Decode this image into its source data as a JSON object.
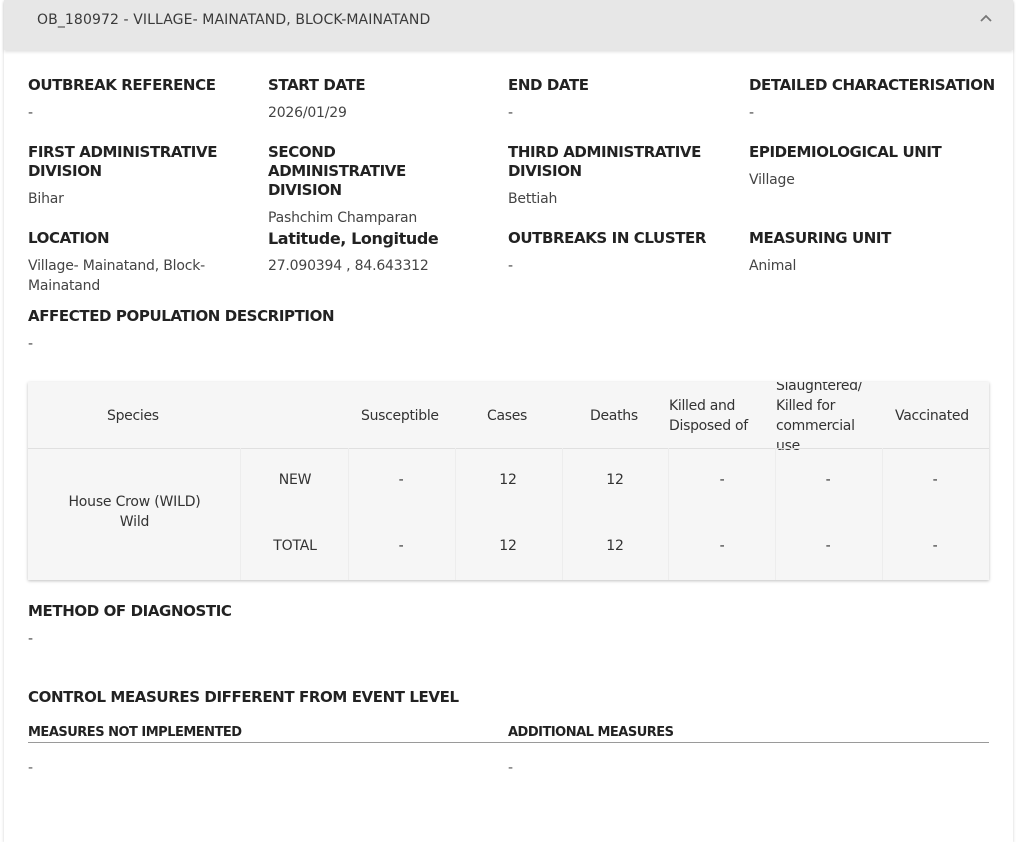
{
  "header": {
    "title": "OB_180972 - VILLAGE- MAINATAND, BLOCK-MAINATAND"
  },
  "fields": {
    "outbreak_reference": {
      "label": "OUTBREAK REFERENCE",
      "value": "-"
    },
    "start_date": {
      "label": "START DATE",
      "value": "2026/01/29"
    },
    "end_date": {
      "label": "END DATE",
      "value": "-"
    },
    "detailed_characterisation": {
      "label": "DETAILED CHARACTERISATION",
      "value": "-"
    },
    "first_admin": {
      "label": "FIRST ADMINISTRATIVE DIVISION",
      "value": "Bihar"
    },
    "second_admin": {
      "label": "SECOND ADMINISTRATIVE DIVISION",
      "value": "Pashchim Champaran"
    },
    "third_admin": {
      "label": "THIRD ADMINISTRATIVE DIVISION",
      "value": "Bettiah"
    },
    "epi_unit": {
      "label": "EPIDEMIOLOGICAL UNIT",
      "value": "Village"
    },
    "location": {
      "label": "LOCATION",
      "value": "Village- Mainatand, Block-Mainatand"
    },
    "lat_long": {
      "label": "Latitude, Longitude",
      "value": "27.090394 , 84.643312"
    },
    "outbreaks_in_cluster": {
      "label": "OUTBREAKS IN CLUSTER",
      "value": "-"
    },
    "measuring_unit": {
      "label": "MEASURING UNIT",
      "value": "Animal"
    },
    "affected_population": {
      "label": "AFFECTED POPULATION DESCRIPTION",
      "value": "-"
    }
  },
  "table": {
    "headers": {
      "species": "Species",
      "susceptible": "Susceptible",
      "cases": "Cases",
      "deaths": "Deaths",
      "killed": "Killed and Disposed of",
      "slaughtered": "Slaughtered/ Killed for commercial use",
      "vaccinated": "Vaccinated"
    },
    "species_name": "House Crow (WILD)",
    "species_type": "Wild",
    "rows": [
      {
        "label": "NEW",
        "susceptible": "-",
        "cases": "12",
        "deaths": "12",
        "killed": "-",
        "slaughtered": "-",
        "vaccinated": "-"
      },
      {
        "label": "TOTAL",
        "susceptible": "-",
        "cases": "12",
        "deaths": "12",
        "killed": "-",
        "slaughtered": "-",
        "vaccinated": "-"
      }
    ]
  },
  "diagnostic": {
    "label": "METHOD OF DIAGNOSTIC",
    "value": "-"
  },
  "control": {
    "title": "CONTROL MEASURES DIFFERENT FROM EVENT LEVEL",
    "not_implemented_label": "MEASURES NOT IMPLEMENTED",
    "not_implemented_value": "-",
    "additional_label": "ADDITIONAL MEASURES",
    "additional_value": "-"
  },
  "icons": {
    "collapse": "chevron-up-icon"
  }
}
